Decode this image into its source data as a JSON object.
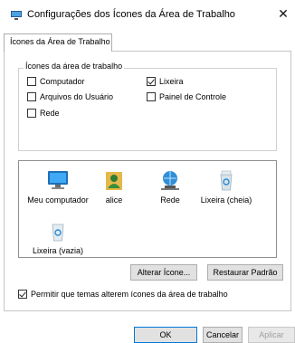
{
  "window": {
    "title": "Configurações dos Ícones da Área de Trabalho",
    "close_glyph": "✕"
  },
  "tab": {
    "label": "Ícones da Área de Trabalho"
  },
  "group": {
    "label": "Ícones da área de trabalho",
    "checkboxes": [
      {
        "label": "Computador",
        "checked": false
      },
      {
        "label": "Lixeira",
        "checked": true
      },
      {
        "label": "Arquivos do Usuário",
        "checked": false
      },
      {
        "label": "Painel de Controle",
        "checked": false
      },
      {
        "label": "Rede",
        "checked": false
      }
    ]
  },
  "icons": [
    {
      "label": "Meu computador",
      "icon": "monitor-icon"
    },
    {
      "label": "alice",
      "icon": "user-folder-icon"
    },
    {
      "label": "Rede",
      "icon": "network-globe-icon"
    },
    {
      "label": "Lixeira (cheia)",
      "icon": "recycle-bin-full-icon"
    },
    {
      "label": "Lixeira (vazia)",
      "icon": "recycle-bin-empty-icon"
    }
  ],
  "buttons": {
    "change_icon": "Alterar Ícone...",
    "restore_default": "Restaurar Padrão",
    "ok": "OK",
    "cancel": "Cancelar",
    "apply": "Aplicar"
  },
  "allow_themes": {
    "label": "Permitir que temas alterem ícones da área de trabalho",
    "checked": true
  },
  "colors": {
    "accent": "#0078d7",
    "border": "#adadad",
    "button_bg": "#e1e1e1"
  }
}
